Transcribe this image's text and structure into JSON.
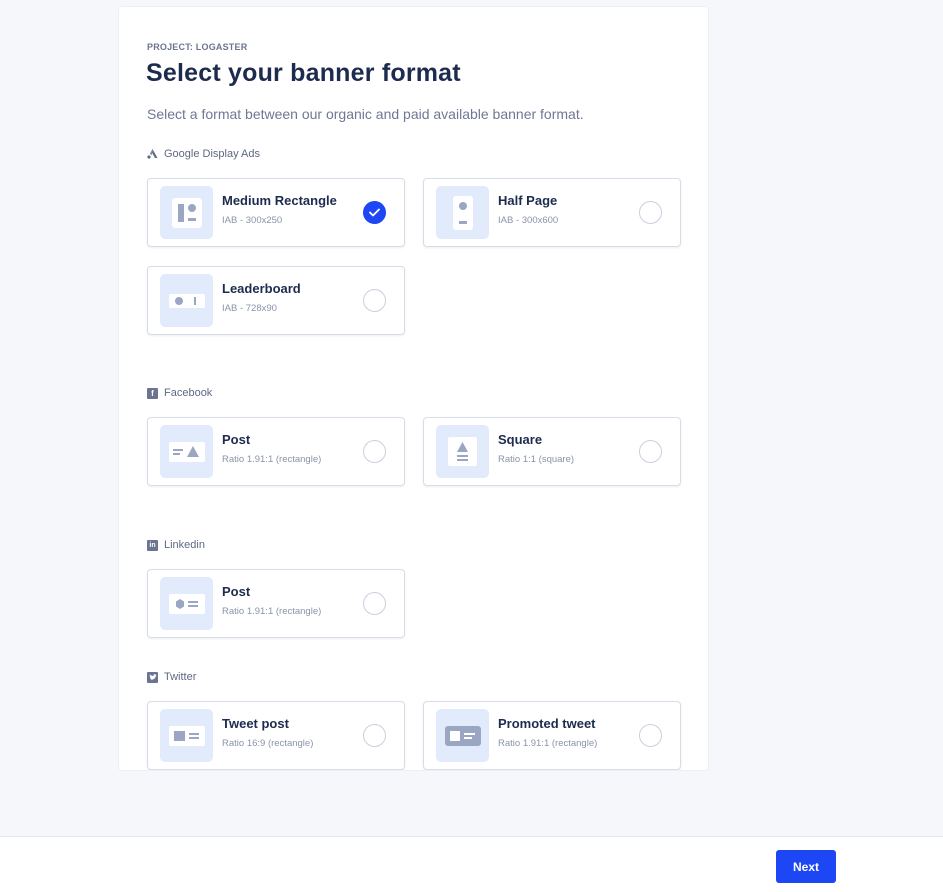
{
  "header": {
    "project": "PROJECT: LOGASTER",
    "title": "Select your banner format",
    "subtitle": "Select a format between our organic and paid available banner format."
  },
  "sections": [
    {
      "label": "Google Display Ads",
      "icon": "google-ads-icon",
      "formats": [
        {
          "title": "Medium Rectangle",
          "sub": "IAB - 300x250",
          "icon": "medium-rectangle-icon",
          "selected": true
        },
        {
          "title": "Half Page",
          "sub": "IAB - 300x600",
          "icon": "half-page-icon",
          "selected": false
        },
        {
          "title": "Leaderboard",
          "sub": "IAB - 728x90",
          "icon": "leaderboard-icon",
          "selected": false
        }
      ]
    },
    {
      "label": "Facebook",
      "icon": "facebook-icon",
      "formats": [
        {
          "title": "Post",
          "sub": "Ratio 1.91:1 (rectangle)",
          "icon": "facebook-post-icon",
          "selected": false
        },
        {
          "title": "Square",
          "sub": "Ratio 1:1 (square)",
          "icon": "square-icon",
          "selected": false
        }
      ]
    },
    {
      "label": "Linkedin",
      "icon": "linkedin-icon",
      "formats": [
        {
          "title": "Post",
          "sub": "Ratio 1.91:1 (rectangle)",
          "icon": "linkedin-post-icon",
          "selected": false
        }
      ]
    },
    {
      "label": "Twitter",
      "icon": "twitter-icon",
      "formats": [
        {
          "title": "Tweet post",
          "sub": "Ratio 16:9 (rectangle)",
          "icon": "tweet-post-icon",
          "selected": false
        },
        {
          "title": "Promoted tweet",
          "sub": "Ratio 1.91:1 (rectangle)",
          "icon": "promoted-tweet-icon",
          "selected": false
        }
      ]
    }
  ],
  "footer": {
    "next_label": "Next"
  },
  "colors": {
    "accent": "#1d46f5",
    "thumb_bg": "#e1ebfc",
    "page_bg": "#f5f7fb"
  }
}
